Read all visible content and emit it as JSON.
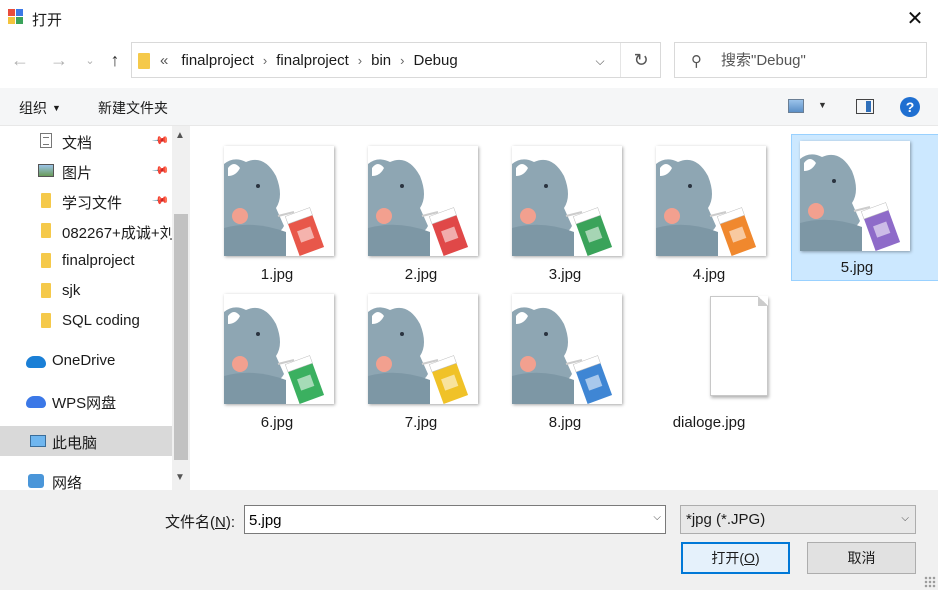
{
  "window": {
    "title": "打开"
  },
  "address": {
    "overflow": "«",
    "crumbs": [
      "finalproject",
      "finalproject",
      "bin",
      "Debug"
    ]
  },
  "search": {
    "placeholder": "搜索\"Debug\""
  },
  "toolbar": {
    "organize": "组织",
    "new_folder": "新建文件夹"
  },
  "sidebar": {
    "items": [
      {
        "label": "文档",
        "icon": "document-icon",
        "pinned": true
      },
      {
        "label": "图片",
        "icon": "picture-icon",
        "pinned": true
      },
      {
        "label": "学习文件",
        "icon": "folder-icon",
        "pinned": true
      },
      {
        "label": "082267+成诚+刘",
        "icon": "folder-icon",
        "pinned": false
      },
      {
        "label": "finalproject",
        "icon": "folder-icon",
        "pinned": false
      },
      {
        "label": "sjk",
        "icon": "folder-icon",
        "pinned": false
      },
      {
        "label": "SQL coding",
        "icon": "folder-icon",
        "pinned": false
      },
      {
        "label": "OneDrive",
        "icon": "onedrive-icon",
        "pinned": false
      },
      {
        "label": "WPS网盘",
        "icon": "wps-cloud-icon",
        "pinned": false
      },
      {
        "label": "此电脑",
        "icon": "this-pc-icon",
        "pinned": false,
        "selected": true
      },
      {
        "label": "网络",
        "icon": "network-icon",
        "pinned": false
      }
    ]
  },
  "files": [
    {
      "name": "1.jpg",
      "carton_color": "#e8574a"
    },
    {
      "name": "2.jpg",
      "carton_color": "#e04848"
    },
    {
      "name": "3.jpg",
      "carton_color": "#3aa35a"
    },
    {
      "name": "4.jpg",
      "carton_color": "#f0882e"
    },
    {
      "name": "5.jpg",
      "carton_color": "#8e6bc9",
      "selected": true
    },
    {
      "name": "6.jpg",
      "carton_color": "#3bb060"
    },
    {
      "name": "7.jpg",
      "carton_color": "#f0c228"
    },
    {
      "name": "8.jpg",
      "carton_color": "#3f86d4"
    },
    {
      "name": "dialoge.jpg",
      "blank": true
    }
  ],
  "footer": {
    "filename_label": "文件名(",
    "filename_key": "N",
    "filename_label_end": "):",
    "filename_value": "5.jpg",
    "filetype": "*jpg (*.JPG)",
    "open_label": "打开(",
    "open_key": "O",
    "open_label_end": ")",
    "cancel_label": "取消"
  }
}
